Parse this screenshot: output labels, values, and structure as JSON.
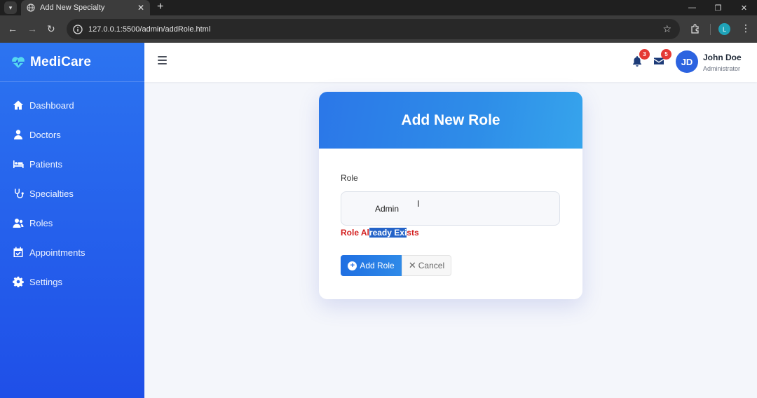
{
  "browser": {
    "tab_title": "Add New Specialty",
    "tab_close": "✕",
    "new_tab": "+",
    "url": "127.0.0.1:5500/admin/addRole.html",
    "profile_initial": "L"
  },
  "sidebar": {
    "brand": "MediCare",
    "items": [
      {
        "label": "Dashboard",
        "icon": "home-icon"
      },
      {
        "label": "Doctors",
        "icon": "doctor-icon"
      },
      {
        "label": "Patients",
        "icon": "bed-icon"
      },
      {
        "label": "Specialties",
        "icon": "stethoscope-icon"
      },
      {
        "label": "Roles",
        "icon": "users-icon"
      },
      {
        "label": "Appointments",
        "icon": "calendar-check-icon"
      },
      {
        "label": "Settings",
        "icon": "gear-icon"
      }
    ],
    "colors": {
      "top": "#2c74f0",
      "bottom": "#1f4fe8"
    }
  },
  "topbar": {
    "notifications_count": "3",
    "messages_count": "5",
    "avatar_initials": "JD",
    "user_name": "John Doe",
    "user_role": "Administrator"
  },
  "card": {
    "title": "Add New Role",
    "role_label": "Role",
    "role_value": "Admin",
    "cursor": "I",
    "error_prefix": "Role Al",
    "error_selected": "ready Exi",
    "error_suffix": "sts",
    "add_button": "Add Role",
    "cancel_button": "Cancel"
  },
  "colors": {
    "accent": "#2b77e8",
    "error": "#d32020",
    "badge": "#e53935"
  }
}
